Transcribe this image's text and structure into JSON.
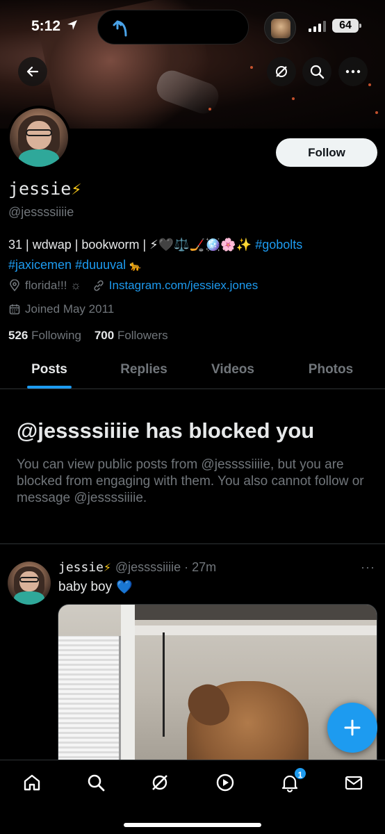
{
  "status_bar": {
    "time": "5:12",
    "battery": "64"
  },
  "profile": {
    "name": "jessie",
    "name_emoji": "⚡",
    "handle": "@jessssiiiie",
    "follow_label": "Follow",
    "bio_text": "31 | wdwap | bookworm | ⚡🖤⚖️🏒🪩🌸✨",
    "bio_hashtag_1": "#gobolts",
    "bio_hashtag_2": "#jaxicemen",
    "bio_hashtag_3": "#duuuval",
    "bio_emoji_end": "🐆",
    "location": "florida!!! ☼",
    "website": "Instagram.com/jessiex.jones",
    "joined": "Joined May 2011",
    "following_count": "526",
    "following_label": "Following",
    "followers_count": "700",
    "followers_label": "Followers"
  },
  "tabs": [
    "Posts",
    "Replies",
    "Videos",
    "Photos"
  ],
  "blocked": {
    "title": "@jessssiiiie has blocked you",
    "body": "You can view public posts from @jessssiiiie, but you are blocked from engaging with them. You also cannot follow or message @jessssiiiie."
  },
  "post": {
    "author": "jessie",
    "author_emoji": "⚡",
    "handle_time": "@jessssiiiie · 27m",
    "more": "···",
    "text": "baby boy",
    "text_emoji": "💙"
  },
  "nav": {
    "notifications_badge": "1"
  },
  "colors": {
    "accent": "#1d9bf0",
    "background": "#000000",
    "muted": "#71767b",
    "text": "#e7e9ea"
  },
  "icons": [
    "back-arrow-icon",
    "grok-icon",
    "search-icon",
    "more-icon",
    "location-icon",
    "link-icon",
    "calendar-icon",
    "compose-plus-icon",
    "home-icon",
    "explore-search-icon",
    "grok-nav-icon",
    "video-play-icon",
    "bell-icon",
    "mail-icon"
  ]
}
